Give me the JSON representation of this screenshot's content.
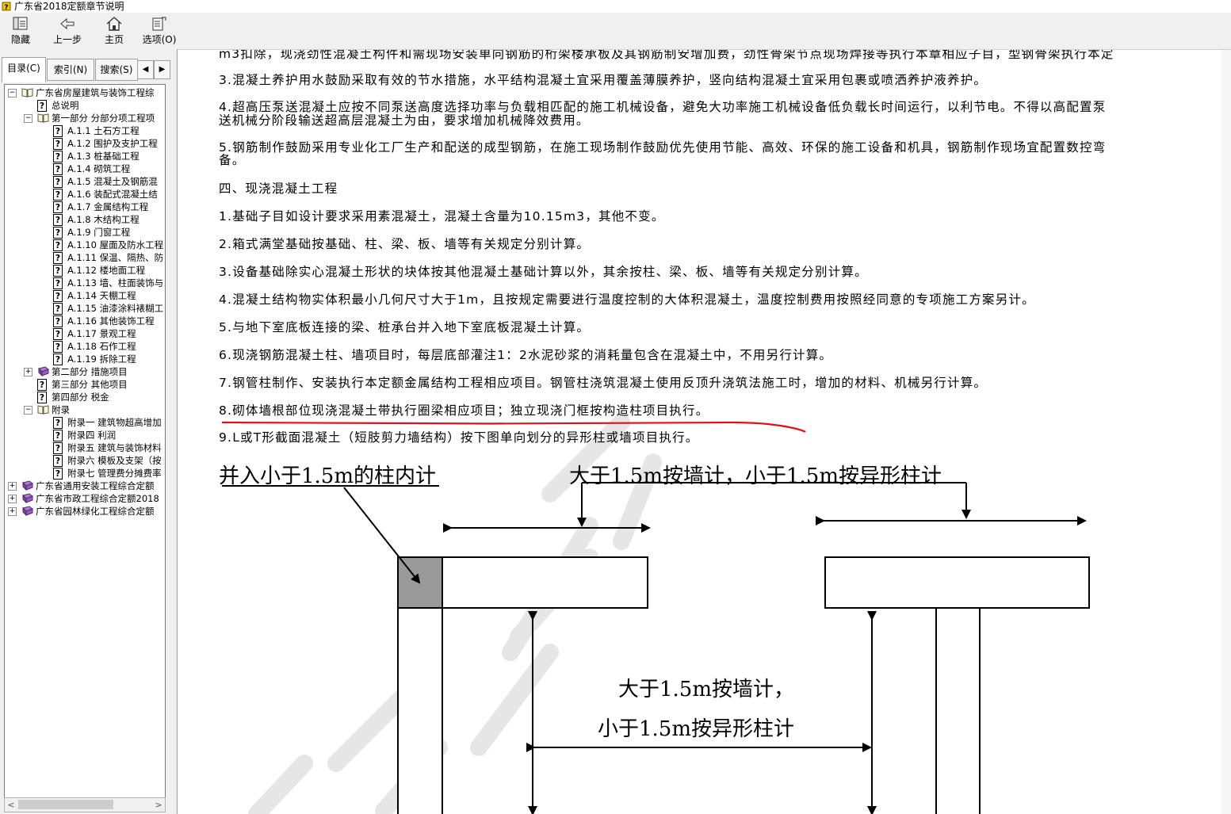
{
  "window": {
    "title": "广东省2018定额章节说明"
  },
  "toolbar": {
    "buttons": [
      {
        "label": "隐藏",
        "icon": "hide-pane-icon"
      },
      {
        "label": "上一步",
        "icon": "back-arrow-icon"
      },
      {
        "label": "主页",
        "icon": "home-icon"
      },
      {
        "label": "选项(O)",
        "icon": "options-icon"
      }
    ]
  },
  "tabs": [
    {
      "label": "目录(C)",
      "active": true
    },
    {
      "label": "索引(N)",
      "active": false
    },
    {
      "label": "搜索(S)",
      "active": false
    }
  ],
  "tree": {
    "items": [
      {
        "label": "广东省房屋建筑与装饰工程综",
        "type": "book-open",
        "expander": "−"
      },
      {
        "label": "总说明",
        "type": "topic"
      },
      {
        "label": "第一部分 分部分项工程项",
        "type": "book-open",
        "expander": "−"
      },
      {
        "label": "A.1.1 土石方工程",
        "type": "topic"
      },
      {
        "label": "A.1.2 围护及支护工程",
        "type": "topic"
      },
      {
        "label": "A.1.3 桩基础工程",
        "type": "topic"
      },
      {
        "label": "A.1.4 砌筑工程",
        "type": "topic"
      },
      {
        "label": "A.1.5 混凝土及钢筋混",
        "type": "topic"
      },
      {
        "label": "A.1.6 装配式混凝土结",
        "type": "topic"
      },
      {
        "label": "A.1.7 金属结构工程",
        "type": "topic"
      },
      {
        "label": "A.1.8 木结构工程",
        "type": "topic"
      },
      {
        "label": "A.1.9 门窗工程",
        "type": "topic"
      },
      {
        "label": "A.1.10 屋面及防水工程",
        "type": "topic"
      },
      {
        "label": "A.1.11 保温、隔热、防",
        "type": "topic"
      },
      {
        "label": "A.1.12 楼地面工程",
        "type": "topic"
      },
      {
        "label": "A.1.13 墙、柱面装饰与",
        "type": "topic"
      },
      {
        "label": "A.1.14 天棚工程",
        "type": "topic"
      },
      {
        "label": "A.1.15 油漆涂料裱糊工",
        "type": "topic"
      },
      {
        "label": "A.1.16 其他装饰工程",
        "type": "topic"
      },
      {
        "label": "A.1.17 景观工程",
        "type": "topic"
      },
      {
        "label": "A.1.18 石作工程",
        "type": "topic"
      },
      {
        "label": "A.1.19 拆除工程",
        "type": "topic"
      },
      {
        "label": "第二部分 措施项目",
        "type": "book-closed",
        "expander": "+"
      },
      {
        "label": "第三部分 其他项目",
        "type": "topic"
      },
      {
        "label": "第四部分 税金",
        "type": "topic"
      },
      {
        "label": "附录",
        "type": "book-open",
        "expander": "−"
      },
      {
        "label": "附录一 建筑物超高增加",
        "type": "topic"
      },
      {
        "label": "附录四 利润",
        "type": "topic"
      },
      {
        "label": "附录五 建筑与装饰材料",
        "type": "topic"
      },
      {
        "label": "附录六 模板及支架（按",
        "type": "topic"
      },
      {
        "label": "附录七 管理费分摊费率",
        "type": "topic"
      },
      {
        "label": "广东省通用安装工程综合定额",
        "type": "book-closed",
        "expander": "+"
      },
      {
        "label": "广东省市政工程综合定额2018",
        "type": "book-closed",
        "expander": "+"
      },
      {
        "label": "广东省园林绿化工程综合定额",
        "type": "book-closed",
        "expander": "+"
      }
    ]
  },
  "content": {
    "paragraphs": [
      {
        "text": "m3扣除，现浇劲性混凝土构件和需现场安装单向钢筋的桁架楼承板及其钢筋制安增加费，劲性骨架节点现场焊接等执行本章相应子目，型钢骨架执行本定"
      },
      {
        "text": "3.混凝土养护用水鼓励采取有效的节水措施，水平结构混凝土宜采用覆盖薄膜养护，竖向结构混凝土宜采用包裹或喷洒养护液养护。"
      },
      {
        "text": "4.超高压泵送混凝土应按不同泵送高度选择功率与负载相匹配的施工机械设备，避免大功率施工机械设备低负载长时间运行，以利节电。不得以高配置泵"
      },
      {
        "text": "送机械分阶段输送超高层混凝土为由，要求增加机械降效费用。"
      },
      {
        "text": "5.钢筋制作鼓励采用专业化工厂生产和配送的成型钢筋，在施工现场制作鼓励优先使用节能、高效、环保的施工设备和机具，钢筋制作现场宜配置数控弯"
      },
      {
        "text": "备。"
      },
      {
        "text": "四、现浇混凝土工程"
      },
      {
        "text": "1.基础子目如设计要求采用素混凝土，混凝土含量为10.15m3，其他不变。"
      },
      {
        "text": "2.箱式满堂基础按基础、柱、梁、板、墙等有关规定分别计算。"
      },
      {
        "text": "3.设备基础除实心混凝土形状的块体按其他混凝土基础计算以外，其余按柱、梁、板、墙等有关规定分别计算。"
      },
      {
        "text": "4.混凝土结构物实体积最小几何尺寸大于1m，且按规定需要进行温度控制的大体积混凝土，温度控制费用按照经同意的专项施工方案另计。"
      },
      {
        "text": "5.与地下室底板连接的梁、桩承台并入地下室底板混凝土计算。"
      },
      {
        "text": "6.现浇钢筋混凝土柱、墙项目时，每层底部灌注1：2水泥砂浆的消耗量包含在混凝土中，不用另行计算。"
      },
      {
        "text": "7.钢管柱制作、安装执行本定额金属结构工程相应项目。钢管柱浇筑混凝土使用反顶升浇筑法施工时，增加的材料、机械另行计算。"
      },
      {
        "text": "8.砌体墙根部位现浇混凝土带执行圈梁相应项目；独立现浇门框按构造柱项目执行。"
      },
      {
        "text": "9.L或T形截面混凝土（短肢剪力墙结构）按下图单向划分的异形柱或墙项目执行。"
      }
    ],
    "figure": {
      "label_left": "并入小于1.5m的柱内计",
      "label_top": "大于1.5m按墙计，小于1.5m按异形柱计",
      "label_mid_line1": "大于1.5m按墙计，",
      "label_mid_line2": "小于1.5m按异形柱计"
    }
  },
  "colors": {
    "annotation_red": "#e0101a",
    "corner_fill": "#9a9a9a",
    "watermark": "#e8e8e8"
  }
}
